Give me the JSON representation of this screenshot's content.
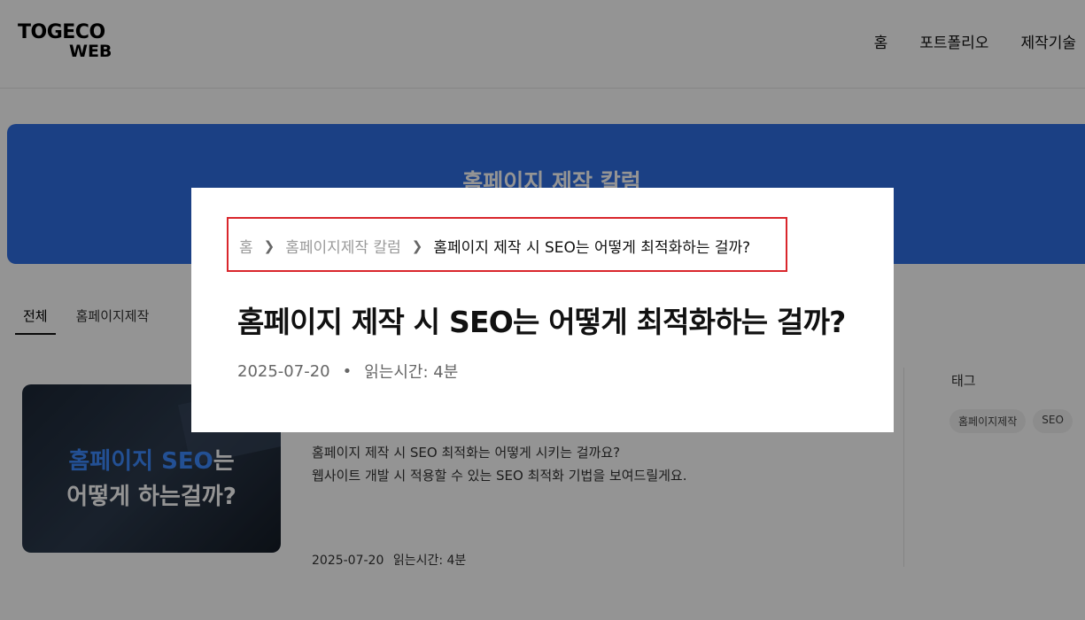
{
  "header": {
    "logo_top": "TOGECO",
    "logo_bottom": "WEB",
    "nav": [
      "홈",
      "포트폴리오",
      "제작기술"
    ]
  },
  "hero": {
    "title": "홈페이지 제작 칼럼"
  },
  "tabs": [
    {
      "label": "전체",
      "active": true
    },
    {
      "label": "홈페이지제작",
      "active": false
    }
  ],
  "card": {
    "thumb_line1_blue": "홈페이지 SEO",
    "thumb_line1_rest": "는",
    "thumb_line2": "어떻게 하는걸까?",
    "desc_line1": "홈페이지 제작 시 SEO 최적화는 어떻게 시키는 걸까요?",
    "desc_line2": "웹사이트 개발 시 적용할 수 있는 SEO 최적화 기법을 보여드릴게요.",
    "date": "2025-07-20",
    "read_time": "읽는시간: 4분"
  },
  "sidebar": {
    "tag_heading": "태그",
    "tags": [
      "홈페이지제작",
      "SEO"
    ]
  },
  "popup": {
    "breadcrumb": {
      "home": "홈",
      "category": "홈페이지제작 칼럼",
      "current": "홈페이지 제작 시 SEO는 어떻게 최적화하는 걸까?"
    },
    "title": "홈페이지 제작 시 SEO는 어떻게 최적화하는 걸까?",
    "date": "2025-07-20",
    "read_time": "읽는시간: 4분"
  },
  "colors": {
    "hero_blue": "#2f6fe4",
    "highlight_red": "#d9262c"
  }
}
